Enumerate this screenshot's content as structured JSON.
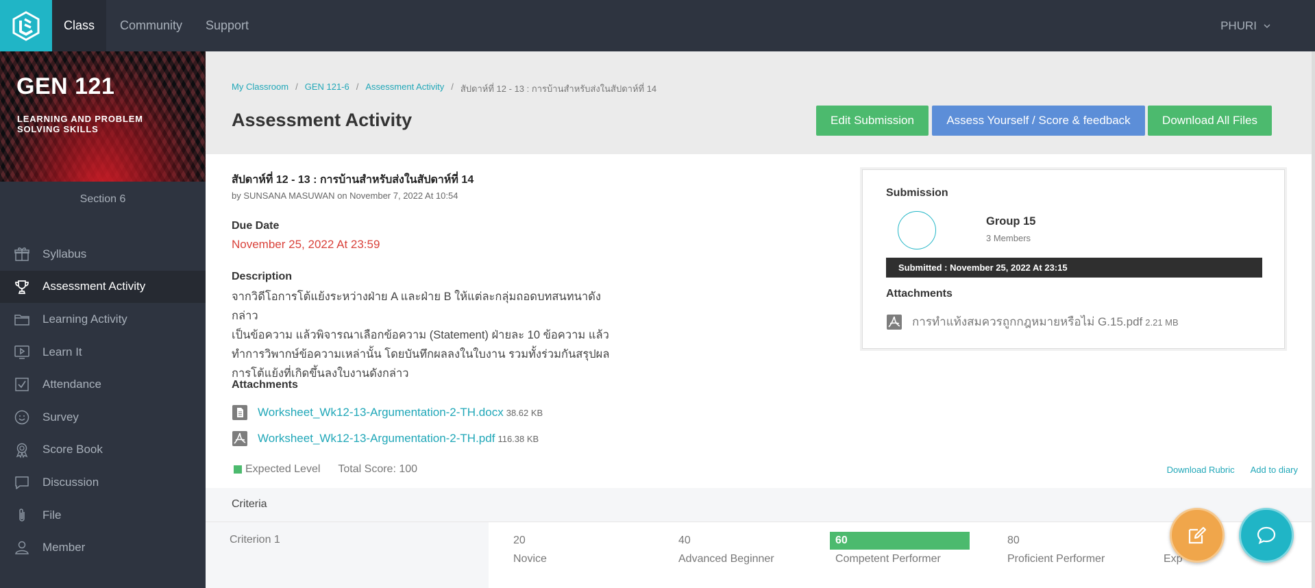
{
  "nav": {
    "items": [
      {
        "label": "Class"
      },
      {
        "label": "Community"
      },
      {
        "label": "Support"
      }
    ],
    "user": "PHURI"
  },
  "course": {
    "code": "GEN 121",
    "name": "LEARNING AND PROBLEM SOLVING SKILLS",
    "section": "Section 6"
  },
  "sidebar": {
    "items": [
      {
        "label": "Syllabus",
        "icon": "gift-icon"
      },
      {
        "label": "Assessment Activity",
        "icon": "trophy-icon"
      },
      {
        "label": "Learning Activity",
        "icon": "folder-icon"
      },
      {
        "label": "Learn It",
        "icon": "video-icon"
      },
      {
        "label": "Attendance",
        "icon": "checkbox-icon"
      },
      {
        "label": "Survey",
        "icon": "smile-icon"
      },
      {
        "label": "Score Book",
        "icon": "award-icon"
      },
      {
        "label": "Discussion",
        "icon": "chat-icon"
      },
      {
        "label": "File",
        "icon": "paperclip-icon"
      },
      {
        "label": "Member",
        "icon": "user-icon"
      }
    ]
  },
  "breadcrumb": {
    "items": [
      "My Classroom",
      "GEN 121-6",
      "Assessment Activity"
    ],
    "current": "สัปดาห์ที่ 12 - 13 : การบ้านสำหรับส่งในสัปดาห์ที่ 14"
  },
  "page": {
    "title": "Assessment Activity",
    "buttons": {
      "edit": "Edit Submission",
      "assess": "Assess Yourself / Score & feedback",
      "download": "Download All Files"
    }
  },
  "activity": {
    "title": "สัปดาห์ที่ 12 - 13 : การบ้านสำหรับส่งในสัปดาห์ที่ 14",
    "byline": "by SUNSANA MASUWAN on November 7, 2022 At 10:54",
    "due_label": "Due Date",
    "due_value": "November 25, 2022 At 23:59",
    "description_label": "Description",
    "description_lines": [
      "จากวิดีโอการโต้แย้งระหว่างฝ่าย A และฝ่าย B ให้แต่ละกลุ่มถอดบทสนทนาดังกล่าว",
      "เป็นข้อความ แล้วพิจารณาเลือกข้อความ (Statement) ฝ่ายละ 10 ข้อความ แล้ว",
      "ทำการวิพากษ์ข้อความเหล่านั้น โดยบันทึกผลลงในใบงาน รวมทั้งร่วมกันสรุปผล",
      "การโต้แย้งที่เกิดขึ้นลงใบงานดังกล่าว"
    ],
    "attachments_label": "Attachments",
    "attachments": [
      {
        "name": "Worksheet_Wk12-13-Argumentation-2-TH.docx",
        "size": "38.62 KB",
        "icon": "doc-file-icon"
      },
      {
        "name": "Worksheet_Wk12-13-Argumentation-2-TH.pdf",
        "size": "116.38 KB",
        "icon": "pdf-file-icon"
      }
    ]
  },
  "score": {
    "expected_level": "Expected Level",
    "total": "Total Score: 100",
    "download_rubric": "Download Rubric",
    "add_to_diary": "Add to diary",
    "expected_color": "#4cba6e"
  },
  "criteria": {
    "header": "Criteria",
    "rows": [
      {
        "name": "Criterion 1",
        "levels": [
          {
            "points": "20",
            "name": "Novice"
          },
          {
            "points": "40",
            "name": "Advanced Beginner"
          },
          {
            "points": "60",
            "name": "Competent Performer",
            "highlighted": true
          },
          {
            "points": "80",
            "name": "Proficient Performer"
          },
          {
            "points": "",
            "name": "Exp"
          }
        ]
      }
    ]
  },
  "submission": {
    "title": "Submission",
    "group_name": "Group 15",
    "members": "3 Members",
    "status": "Submitted : November 25, 2022 At 23:15",
    "attachments_label": "Attachments",
    "file_name": "การทำแท้งสมควรถูกกฎหมายหรือไม่ G.15.pdf",
    "file_size": "2.21 MB"
  },
  "colors": {
    "topbar": "#2e3440",
    "accent": "#20b5c6",
    "green": "#4cba6e",
    "blue": "#5c8ed8",
    "due_red": "#d9413a",
    "fab_orange": "#f0a64b"
  }
}
